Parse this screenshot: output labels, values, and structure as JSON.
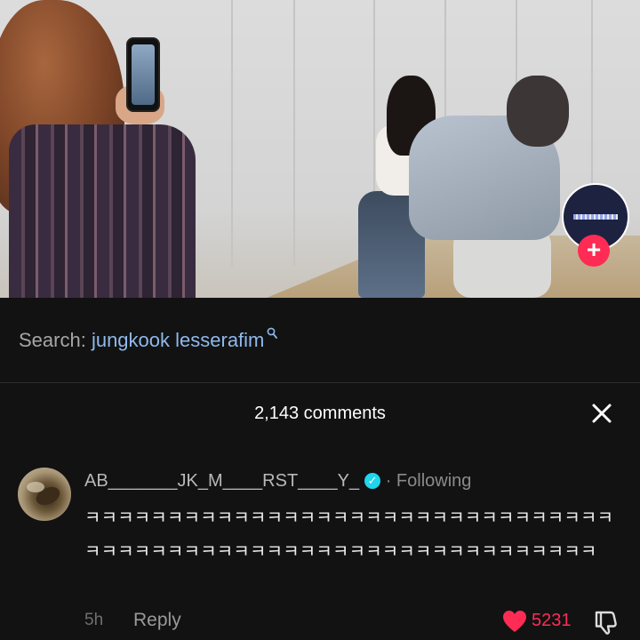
{
  "video": {
    "follow_plus": "+"
  },
  "search": {
    "prefix": "Search:",
    "query": "jungkook lesserafim",
    "icon": "search-icon"
  },
  "comments": {
    "count_label": "2,143 comments",
    "close_icon": "close-icon"
  },
  "comment": {
    "username": "AB_______JK_M____RST____Y_",
    "verified_icon": "verified-badge-icon",
    "separator": "·",
    "follow_status": "Following",
    "text": "ㅋㅋㅋㅋㅋㅋㅋㅋㅋㅋㅋㅋㅋㅋㅋㅋㅋㅋㅋㅋㅋㅋㅋㅋㅋㅋㅋㅋㅋㅋㅋㅋㅋㅋㅋㅋㅋㅋㅋㅋㅋㅋㅋㅋㅋㅋㅋㅋㅋㅋㅋㅋㅋㅋㅋㅋㅋㅋㅋㅋㅋㅋㅋ",
    "time": "5h",
    "reply_label": "Reply",
    "like_count": "5231",
    "like_icon": "heart-icon",
    "dislike_icon": "dislike-icon"
  },
  "colors": {
    "accent": "#fe2c55",
    "link": "#8fb9ec",
    "background": "#121212"
  }
}
